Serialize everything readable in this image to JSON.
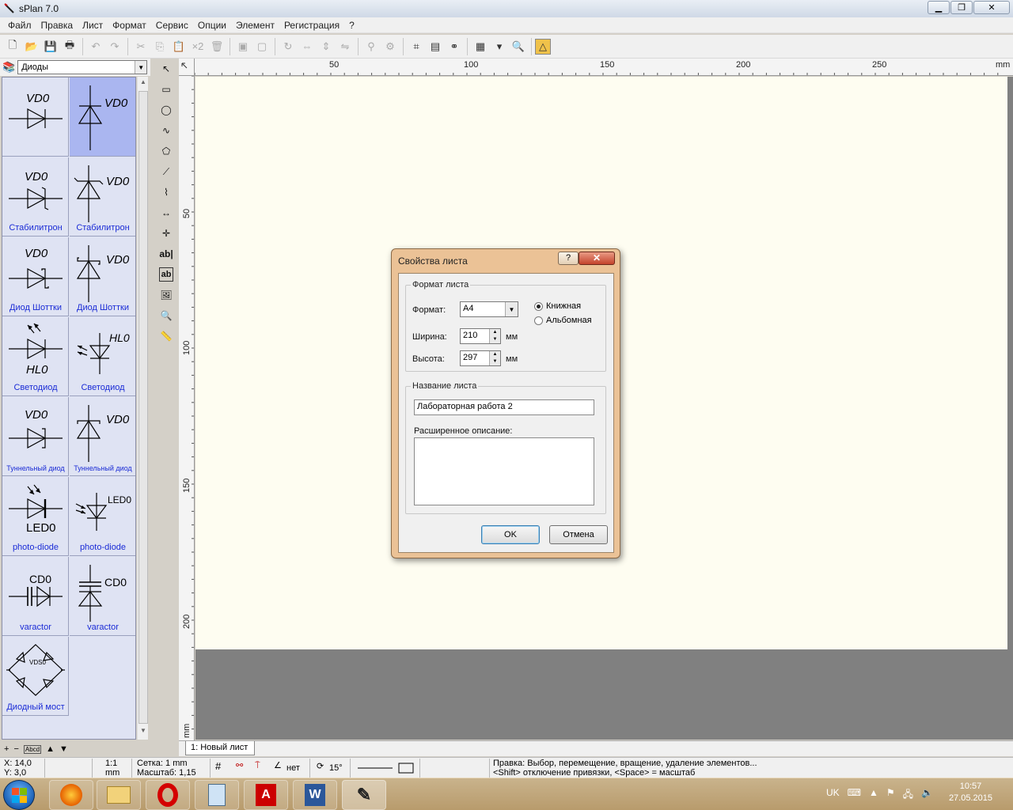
{
  "app": {
    "title": "sPlan 7.0"
  },
  "menu": [
    "Файл",
    "Правка",
    "Лист",
    "Формат",
    "Сервис",
    "Опции",
    "Элемент",
    "Регистрация",
    "?"
  ],
  "library": {
    "selected": "Диоды",
    "cells": [
      {
        "name": "VD0",
        "label": ""
      },
      {
        "name": "VD0",
        "label": ""
      },
      {
        "name": "VD0",
        "label": "Стабилитрон"
      },
      {
        "name": "VD0",
        "label": "Стабилитрон"
      },
      {
        "name": "VD0",
        "label": "Диод Шоттки"
      },
      {
        "name": "VD0",
        "label": "Диод Шоттки"
      },
      {
        "name": "HL0",
        "label": "Светодиод"
      },
      {
        "name": "HL0",
        "label": "Светодиод"
      },
      {
        "name": "VD0",
        "label": "Туннельный диод"
      },
      {
        "name": "VD0",
        "label": "Туннельный диод"
      },
      {
        "name": "LED0",
        "label": "photo-diode"
      },
      {
        "name": "LED0",
        "label": "photo-diode"
      },
      {
        "name": "CD0",
        "label": "varactor"
      },
      {
        "name": "CD0",
        "label": "varactor"
      },
      {
        "name": "VDS0",
        "label": "Диодный мост"
      }
    ],
    "footer": [
      "+",
      "−",
      "Abcd",
      "▲",
      "▼"
    ]
  },
  "ruler": {
    "h": [
      "50",
      "100",
      "150",
      "200",
      "250",
      "mm"
    ],
    "v": [
      "50",
      "100",
      "150",
      "200",
      "mm"
    ]
  },
  "sheet_tab": "1: Новый лист",
  "status": {
    "x": "X: 14,0",
    "y": "Y: 3,0",
    "scale_ratio": "1:1",
    "unit": "mm",
    "grid": "Сетка: 1 mm",
    "zoom": "Масштаб:  1,15",
    "angle_snap": "нет",
    "rotate": "15°",
    "hint1": "Правка: Выбор, перемещение, вращение, удаление элементов...",
    "hint2": "<Shift> отключение привязки, <Space> = масштаб"
  },
  "dialog": {
    "title": "Свойства листа",
    "help": "?",
    "close": "✕",
    "format_group": "Формат листа",
    "format_label": "Формат:",
    "format_value": "A4",
    "portrait": "Книжная",
    "landscape": "Альбомная",
    "width_label": "Ширина:",
    "width_value": "210",
    "height_label": "Высота:",
    "height_value": "297",
    "unit": "мм",
    "name_group": "Название листа",
    "name_value": "Лабораторная работа 2",
    "desc_label": "Расширенное описание:",
    "desc_value": "",
    "ok": "OK",
    "cancel": "Отмена"
  },
  "taskbar": {
    "lang": "UK",
    "time": "10:57",
    "date": "27.05.2015"
  }
}
